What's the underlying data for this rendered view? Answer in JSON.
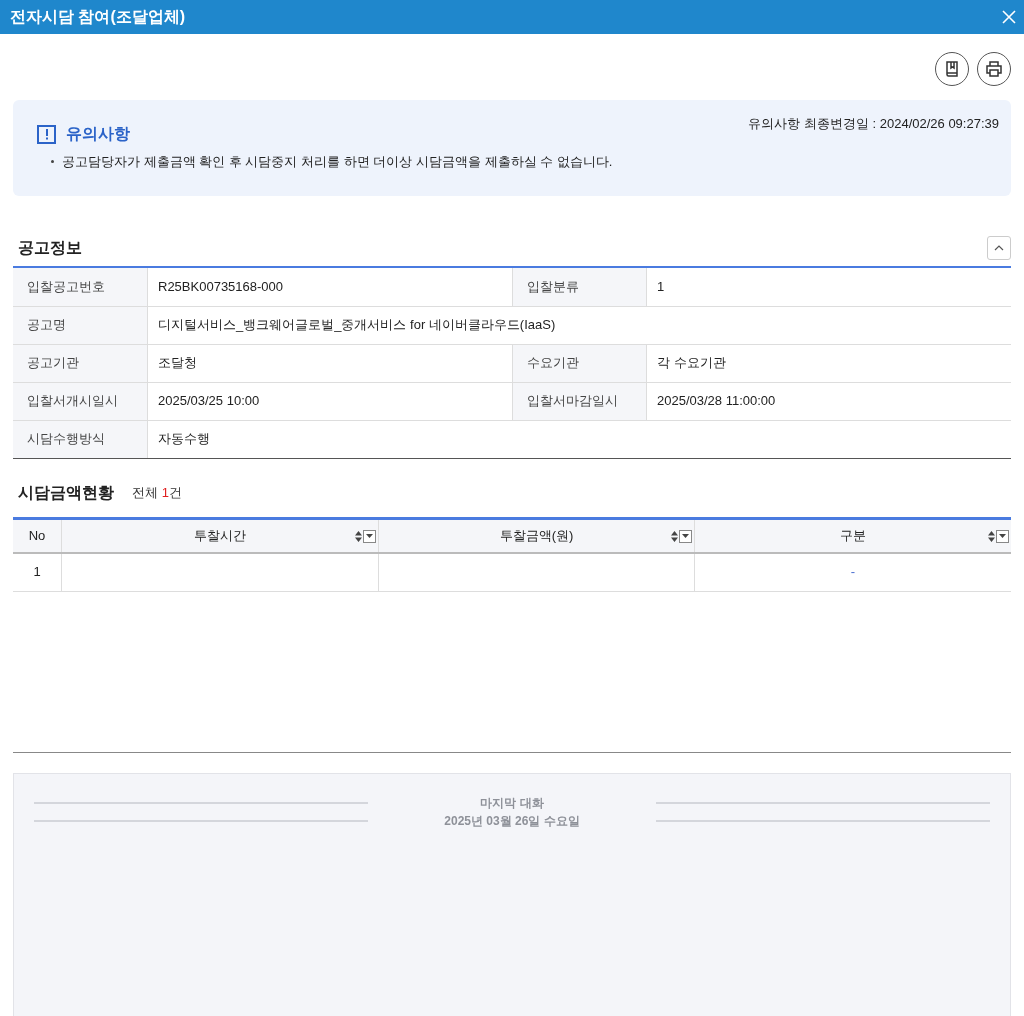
{
  "window": {
    "title": "전자시담 참여(조달업체)"
  },
  "notice": {
    "title": "유의사항",
    "updated": "유의사항 최종변경일 : 2024/02/26 09:27:39",
    "items": [
      "공고담당자가 제출금액 확인 후 시담중지 처리를 하면 더이상 시담금액을 제출하실 수 없습니다."
    ]
  },
  "info": {
    "title": "공고정보",
    "expanded": true,
    "rows": [
      [
        {
          "label": "입찰공고번호",
          "value": "R25BK00735168-000"
        },
        {
          "label": "입찰분류",
          "value": "1"
        }
      ],
      [
        {
          "label": "공고명",
          "value": "디지털서비스_뱅크웨어글로벌_중개서비스 for 네이버클라우드(IaaS)"
        }
      ],
      [
        {
          "label": "공고기관",
          "value": "조달청"
        },
        {
          "label": "수요기관",
          "value": "각 수요기관"
        }
      ],
      [
        {
          "label": "입찰서개시일시",
          "value": "2025/03/25 10:00"
        },
        {
          "label": "입찰서마감일시",
          "value": "2025/03/28 11:00:00"
        }
      ],
      [
        {
          "label": "시담수행방식",
          "value": "자동수행"
        }
      ]
    ]
  },
  "bids": {
    "title": "시담금액현황",
    "total_prefix": "전체",
    "total_count": "1",
    "total_suffix": "건",
    "columns": [
      {
        "label": "No",
        "sortable": false
      },
      {
        "label": "투찰시간",
        "sortable": true
      },
      {
        "label": "투찰금액(원)",
        "sortable": true
      },
      {
        "label": "구분",
        "sortable": true
      }
    ],
    "rows": [
      [
        "1",
        "",
        "",
        "-"
      ]
    ]
  },
  "chat": {
    "caption": "마지막 대화",
    "date": "2025년 03월 26일 수요일"
  }
}
